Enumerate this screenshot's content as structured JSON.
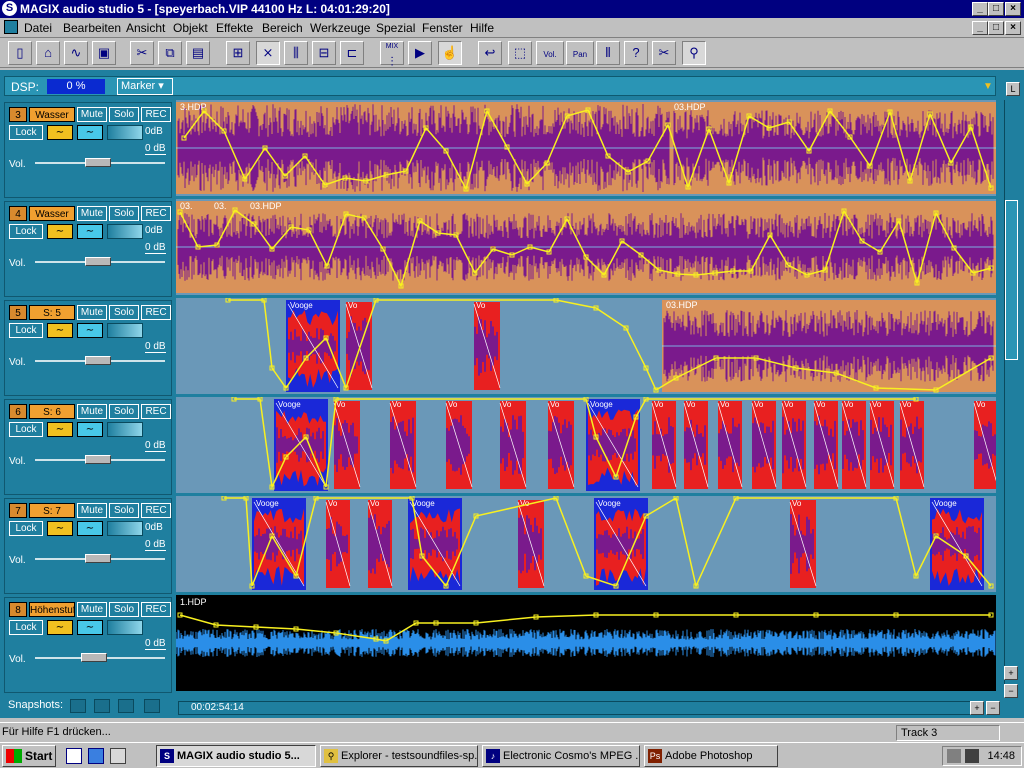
{
  "window": {
    "title": "MAGIX audio studio 5 - [speyerbach.VIP   44100 Hz L: 04:01:29:20]",
    "minimize": "_",
    "maximize": "□",
    "close": "×"
  },
  "menu": [
    "Datei",
    "Bearbeiten",
    "Ansicht",
    "Objekt",
    "Effekte",
    "Bereich",
    "Werkzeuge",
    "Spezial",
    "Fenster",
    "Hilfe"
  ],
  "toolbar": {
    "icons": [
      "new-file-icon",
      "open-file-icon",
      "wave-icon",
      "save-icon",
      "cut-icon",
      "copy-icon",
      "paste-icon",
      "group-icon",
      "crossfade-icon",
      "split-icon",
      "object-icon",
      "align-icon",
      "mixer-icon",
      "play-object-icon",
      "hand-icon",
      "undo-icon",
      "select-icon",
      "vol-curve-icon",
      "pan-curve-icon",
      "marker-icon",
      "help-pointer-icon",
      "scissors-icon",
      "zoom-icon"
    ],
    "labels": {
      "vol": "Vol.",
      "pan": "Pan",
      "mix": "MIX"
    }
  },
  "dsp": {
    "label": "DSP:",
    "value": "0 %",
    "marker_label": "Marker"
  },
  "tracks": [
    {
      "num": "3",
      "name": "Wasser",
      "mute": "Mute",
      "solo": "Solo",
      "rec": "REC",
      "lock": "Lock",
      "db1": "0dB",
      "db2": "0 dB",
      "vol": "Vol.",
      "clips": [
        "3.HDP",
        "03.HDP"
      ]
    },
    {
      "num": "4",
      "name": "Wasser",
      "mute": "Mute",
      "solo": "Solo",
      "rec": "REC",
      "lock": "Lock",
      "db1": "0dB",
      "db2": "0 dB",
      "vol": "Vol.",
      "clips": [
        "03.",
        "03.",
        "03.HDP"
      ]
    },
    {
      "num": "5",
      "name": "S: 5",
      "mute": "Mute",
      "solo": "Solo",
      "rec": "REC",
      "lock": "Lock",
      "db1": "",
      "db2": "0 dB",
      "vol": "Vol.",
      "clips": [
        "Vooge",
        "Vo",
        "Vo",
        "03.HDP"
      ]
    },
    {
      "num": "6",
      "name": "S: 6",
      "mute": "Mute",
      "solo": "Solo",
      "rec": "REC",
      "lock": "Lock",
      "db1": "",
      "db2": "0 dB",
      "vol": "Vol.",
      "clips": [
        "Vooge",
        "Vo",
        "Vo",
        "Vo",
        "Vo",
        "Vo",
        "Vooge",
        "Vo",
        "Vo",
        "Vo",
        "Vo",
        "Vo",
        "Vo",
        "Vo",
        "Vo",
        "Vo"
      ]
    },
    {
      "num": "7",
      "name": "S: 7",
      "mute": "Mute",
      "solo": "Solo",
      "rec": "REC",
      "lock": "Lock",
      "db1": "0dB",
      "db2": "0 dB",
      "vol": "Vol.",
      "clips": [
        "Vooge",
        "Vo",
        "Vo",
        "Vooge",
        "Vo",
        "Vooge",
        "Vo",
        "Vooge"
      ]
    },
    {
      "num": "8",
      "name": "Höhenstuf",
      "mute": "Mute",
      "solo": "Solo",
      "rec": "REC",
      "lock": "Lock",
      "db1": "",
      "db2": "0 dB",
      "vol": "Vol.",
      "clips": [
        "1.HDP"
      ]
    }
  ],
  "snapshots": {
    "label": "Snapshots:"
  },
  "timecode": "00:02:54:14",
  "status": {
    "help": "Für Hilfe F1 drücken...",
    "track": "Track 3"
  },
  "taskbar": {
    "start": "Start",
    "tasks": [
      "MAGIX audio studio 5...",
      "Explorer - testsoundfiles-sp...",
      "Electronic Cosmo's MPEG ...",
      "Adobe Photoshop"
    ],
    "clock": "14:48"
  },
  "colors": {
    "accent_bg": "#1f7f9f",
    "clip_orange": "#d9925a",
    "wave_purple": "#7a1a8c",
    "clip_red": "#e82020",
    "clip_blue": "#1a28d8",
    "curve_yellow": "#f8f020",
    "wave_blue": "#2a8ee8"
  }
}
